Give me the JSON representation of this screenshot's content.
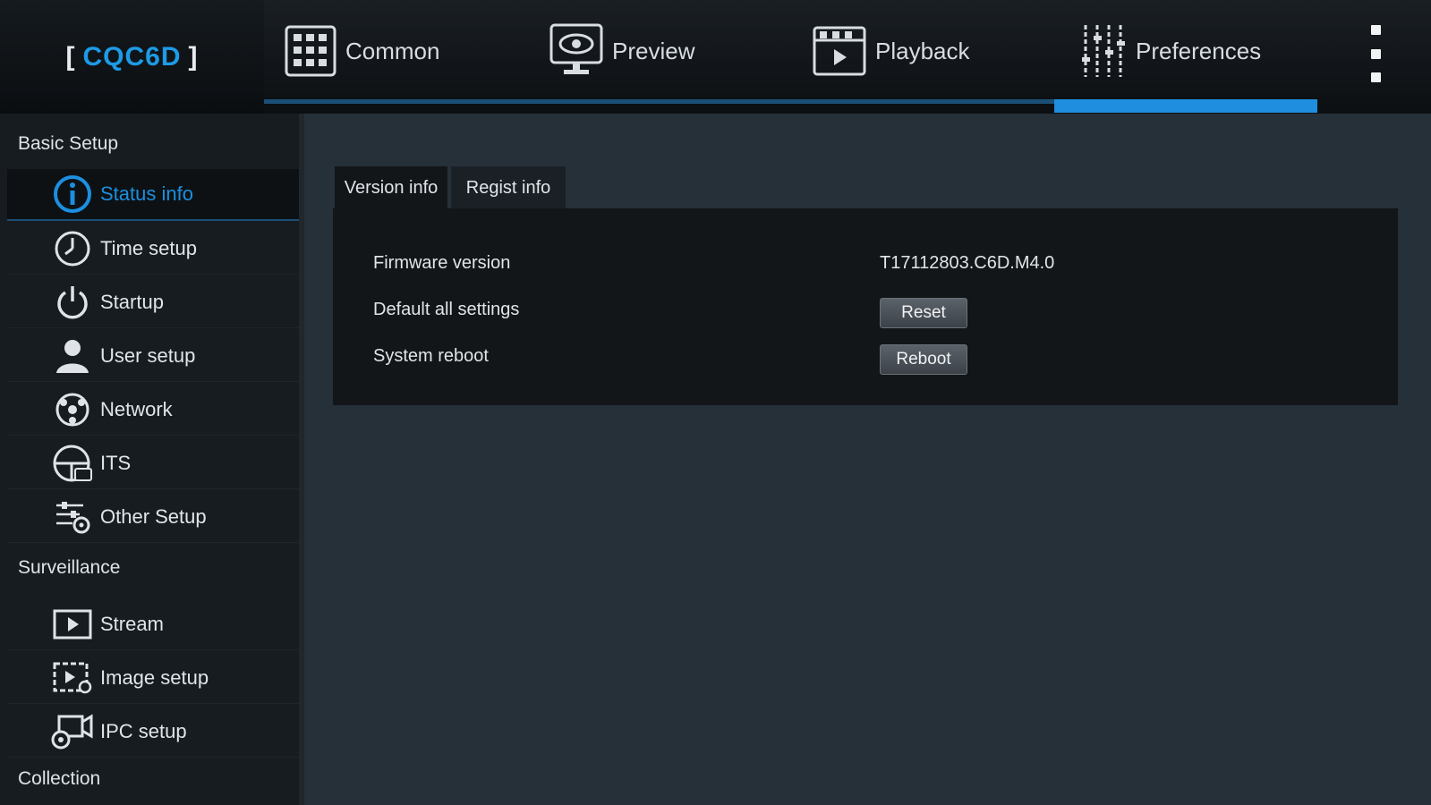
{
  "brand": {
    "open": "[",
    "name": "CQC6D",
    "close": "]"
  },
  "colors": {
    "accent": "#1f8ede",
    "background": "#263038",
    "sidebar": "#171c21",
    "panel": "#121619"
  },
  "nav": {
    "tabs": [
      {
        "label": "Common",
        "icon": "grid-icon"
      },
      {
        "label": "Preview",
        "icon": "monitor-eye-icon"
      },
      {
        "label": "Playback",
        "icon": "clapper-play-icon"
      },
      {
        "label": "Preferences",
        "icon": "sliders-icon"
      }
    ],
    "active": "Preferences"
  },
  "sidebar": {
    "sections": [
      {
        "title": "Basic Setup",
        "items": [
          {
            "label": "Status info",
            "icon": "info-icon",
            "active": true
          },
          {
            "label": "Time setup",
            "icon": "clock-icon"
          },
          {
            "label": "Startup",
            "icon": "power-icon"
          },
          {
            "label": "User setup",
            "icon": "user-icon"
          },
          {
            "label": "Network",
            "icon": "network-icon"
          },
          {
            "label": "ITS",
            "icon": "steering-wheel-icon"
          },
          {
            "label": "Other Setup",
            "icon": "settings-sliders-icon"
          }
        ]
      },
      {
        "title": "Surveillance",
        "items": [
          {
            "label": "Stream",
            "icon": "stream-play-icon"
          },
          {
            "label": "Image setup",
            "icon": "image-settings-icon"
          },
          {
            "label": "IPC setup",
            "icon": "camera-gear-icon"
          }
        ]
      },
      {
        "title": "Collection",
        "items": []
      }
    ]
  },
  "content": {
    "tabs": [
      {
        "label": "Version info",
        "active": true
      },
      {
        "label": "Regist info"
      }
    ],
    "rows": [
      {
        "label": "Firmware version",
        "value": "T17112803.C6D.M4.0"
      },
      {
        "label": "Default all settings",
        "button": "Reset"
      },
      {
        "label": "System reboot",
        "button": "Reboot"
      }
    ]
  }
}
